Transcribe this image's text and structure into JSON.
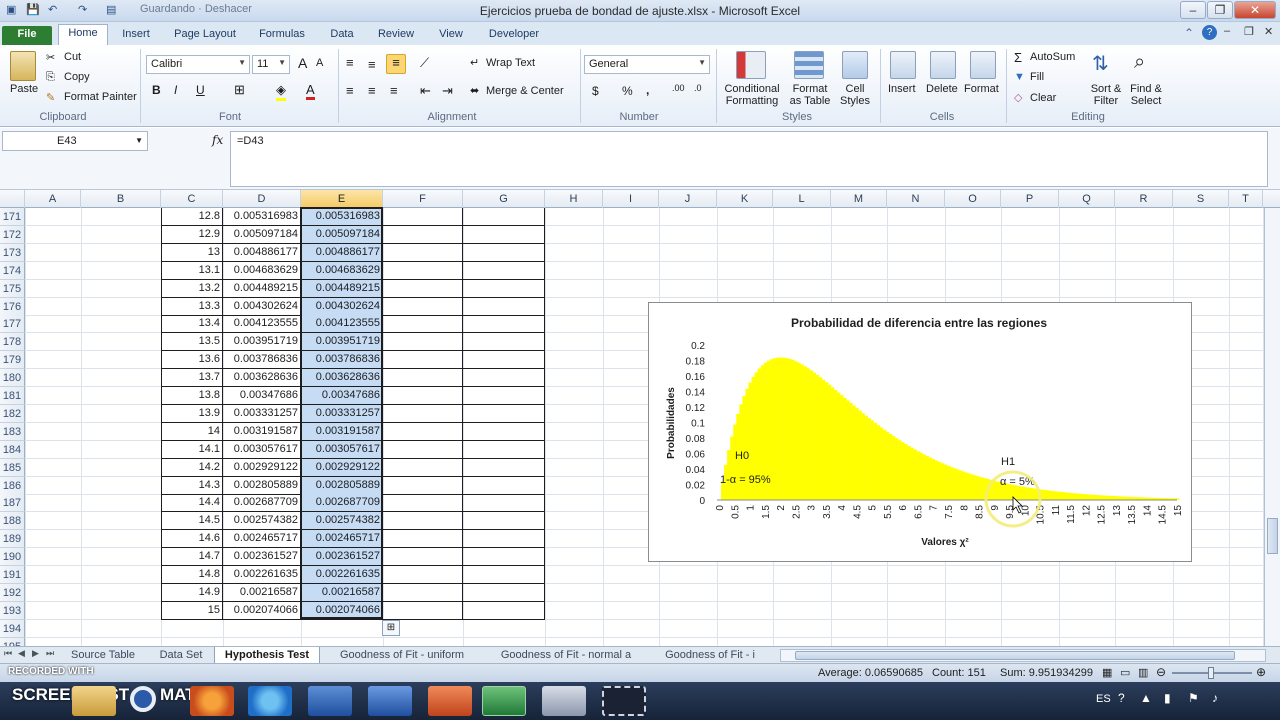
{
  "window": {
    "title": "Ejercicios prueba de bondad de ajuste.xlsx  -  Microsoft Excel",
    "qat_hint": "Guardando · Deshacer"
  },
  "tabs": [
    "File",
    "Home",
    "Insert",
    "Page Layout",
    "Formulas",
    "Data",
    "Review",
    "View",
    "Developer"
  ],
  "ribbon": {
    "clipboard": {
      "paste": "Paste",
      "cut": "Cut",
      "copy": "Copy",
      "format_painter": "Format Painter",
      "label": "Clipboard"
    },
    "font": {
      "name": "Calibri",
      "size": "11",
      "label": "Font",
      "bold": "B",
      "italic": "I",
      "underline": "U"
    },
    "alignment": {
      "wrap": "Wrap Text",
      "merge": "Merge & Center",
      "label": "Alignment"
    },
    "number": {
      "format": "General",
      "currency": "$",
      "percent": "%",
      "comma": ",",
      "label": "Number"
    },
    "styles": {
      "conditional": "Conditional Formatting",
      "format_table": "Format as Table",
      "cell_styles": "Cell Styles",
      "label": "Styles"
    },
    "cells": {
      "insert": "Insert",
      "delete": "Delete",
      "format": "Format",
      "label": "Cells"
    },
    "editing": {
      "autosum": "AutoSum",
      "fill": "Fill",
      "clear": "Clear",
      "sort": "Sort & Filter",
      "find": "Find & Select",
      "label": "Editing"
    }
  },
  "formula_bar": {
    "name_box": "E43",
    "fx": "fx",
    "formula": "=D43"
  },
  "columns": [
    "A",
    "B",
    "C",
    "D",
    "E",
    "F",
    "G",
    "H",
    "I",
    "J",
    "K",
    "L",
    "M",
    "N",
    "O",
    "P",
    "Q",
    "R",
    "S",
    "T"
  ],
  "rows": [
    {
      "n": "171",
      "c": "12.8",
      "d": "0.005316983",
      "e": "0.005316983"
    },
    {
      "n": "172",
      "c": "12.9",
      "d": "0.005097184",
      "e": "0.005097184"
    },
    {
      "n": "173",
      "c": "13",
      "d": "0.004886177",
      "e": "0.004886177"
    },
    {
      "n": "174",
      "c": "13.1",
      "d": "0.004683629",
      "e": "0.004683629"
    },
    {
      "n": "175",
      "c": "13.2",
      "d": "0.004489215",
      "e": "0.004489215"
    },
    {
      "n": "176",
      "c": "13.3",
      "d": "0.004302624",
      "e": "0.004302624"
    },
    {
      "n": "177",
      "c": "13.4",
      "d": "0.004123555",
      "e": "0.004123555"
    },
    {
      "n": "178",
      "c": "13.5",
      "d": "0.003951719",
      "e": "0.003951719"
    },
    {
      "n": "179",
      "c": "13.6",
      "d": "0.003786836",
      "e": "0.003786836"
    },
    {
      "n": "180",
      "c": "13.7",
      "d": "0.003628636",
      "e": "0.003628636"
    },
    {
      "n": "181",
      "c": "13.8",
      "d": "0.00347686",
      "e": "0.00347686"
    },
    {
      "n": "182",
      "c": "13.9",
      "d": "0.003331257",
      "e": "0.003331257"
    },
    {
      "n": "183",
      "c": "14",
      "d": "0.003191587",
      "e": "0.003191587"
    },
    {
      "n": "184",
      "c": "14.1",
      "d": "0.003057617",
      "e": "0.003057617"
    },
    {
      "n": "185",
      "c": "14.2",
      "d": "0.002929122",
      "e": "0.002929122"
    },
    {
      "n": "186",
      "c": "14.3",
      "d": "0.002805889",
      "e": "0.002805889"
    },
    {
      "n": "187",
      "c": "14.4",
      "d": "0.002687709",
      "e": "0.002687709"
    },
    {
      "n": "188",
      "c": "14.5",
      "d": "0.002574382",
      "e": "0.002574382"
    },
    {
      "n": "189",
      "c": "14.6",
      "d": "0.002465717",
      "e": "0.002465717"
    },
    {
      "n": "190",
      "c": "14.7",
      "d": "0.002361527",
      "e": "0.002361527"
    },
    {
      "n": "191",
      "c": "14.8",
      "d": "0.002261635",
      "e": "0.002261635"
    },
    {
      "n": "192",
      "c": "14.9",
      "d": "0.00216587",
      "e": "0.00216587"
    },
    {
      "n": "193",
      "c": "15",
      "d": "0.002074066",
      "e": "0.002074066"
    },
    {
      "n": "194",
      "c": "",
      "d": "",
      "e": ""
    },
    {
      "n": "195",
      "c": "",
      "d": "",
      "e": ""
    }
  ],
  "chart_data": {
    "type": "bar",
    "title": "Probabilidad  de diferencia entre las regiones",
    "xlabel": "Valores χ²",
    "ylabel": "Probabilidades",
    "ylim": [
      0,
      0.2
    ],
    "yticks": [
      "0",
      "0.02",
      "0.04",
      "0.06",
      "0.08",
      "0.1",
      "0.12",
      "0.14",
      "0.16",
      "0.18",
      "0.2"
    ],
    "xticks": [
      "0",
      "0.5",
      "1",
      "1.5",
      "2",
      "2.5",
      "3",
      "3.5",
      "4",
      "4.5",
      "5",
      "5.5",
      "6",
      "6.5",
      "7",
      "7.5",
      "8",
      "8.5",
      "9",
      "9.5",
      "10",
      "10.5",
      "11",
      "11.5",
      "12",
      "12.5",
      "13",
      "13.5",
      "14",
      "14.5",
      "15"
    ],
    "distribution": "chi-square, df = 4",
    "x_range": [
      0,
      15
    ],
    "x_step": 0.1,
    "annotations": {
      "h0": "H0",
      "confidence": "1-α = 95%",
      "h1": "H1",
      "alpha": "α = 5%"
    },
    "bar_color": "#ffff00",
    "grid": false,
    "legend": "none"
  },
  "sheet_tabs": [
    "Source Table",
    "Data Set",
    "Hypothesis Test",
    "Goodness of Fit - uniform",
    "Goodness of Fit - normal a",
    "Goodness of Fit - i"
  ],
  "active_sheet": "Hypothesis Test",
  "status": {
    "average": "Average: 0.06590685",
    "count": "Count: 151",
    "sum": "Sum: 9.951934299"
  },
  "watermark": {
    "line1": "RECORDED WITH",
    "line2": "SCREENCAST",
    "line3": "MATIC"
  },
  "taskbar": {
    "lang": "ES"
  }
}
